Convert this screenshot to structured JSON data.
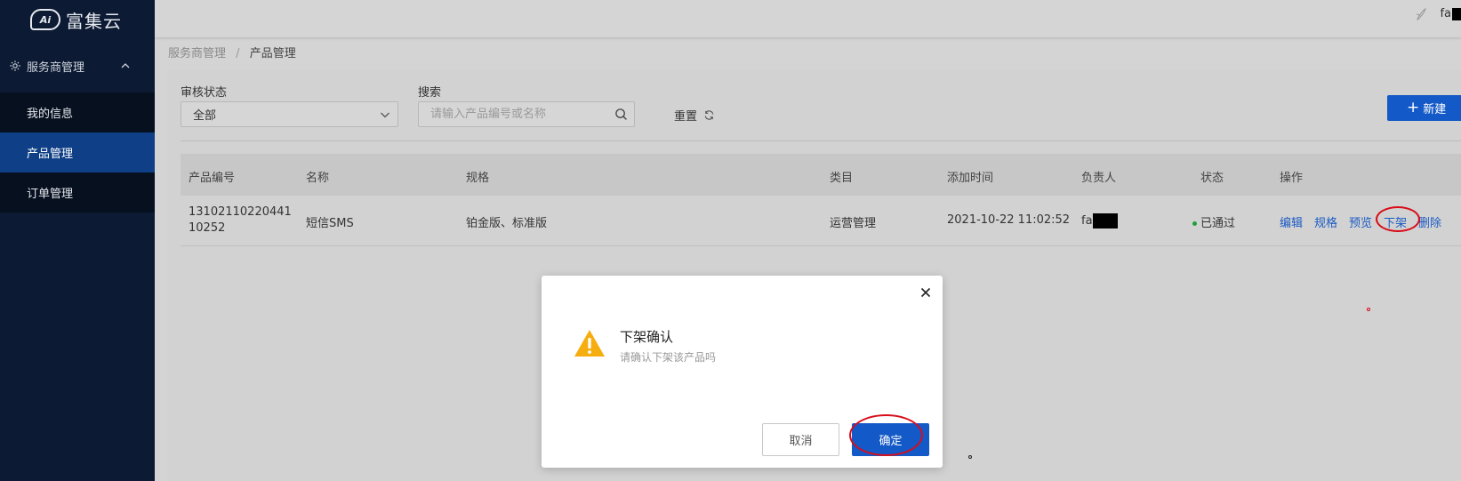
{
  "app": {
    "brand_logo_text": "Ai",
    "brand_name": "富集云"
  },
  "sidebar": {
    "group_label": "服务商管理",
    "items": [
      {
        "label": "我的信息",
        "active": false
      },
      {
        "label": "产品管理",
        "active": true
      },
      {
        "label": "订单管理",
        "active": false
      }
    ]
  },
  "header": {
    "user_name": "fa"
  },
  "breadcrumb": {
    "parent": "服务商管理",
    "separator": "/",
    "current": "产品管理"
  },
  "filters": {
    "status_label": "审核状态",
    "status_value": "全部",
    "search_label": "搜索",
    "search_placeholder": "请输入产品编号或名称",
    "reset_label": "重置",
    "new_label": "新建"
  },
  "table": {
    "columns": [
      "产品编号",
      "名称",
      "规格",
      "类目",
      "添加时间",
      "负责人",
      "状态",
      "操作"
    ],
    "rows": [
      {
        "product_id": "1310211022044110252",
        "name": "短信SMS",
        "spec": "铂金版、标准版",
        "category": "运营管理",
        "added_time": "2021-10-22 11:02:52",
        "owner": "fa",
        "status": "已通过",
        "actions": [
          "编辑",
          "规格",
          "预览",
          "下架",
          "删除"
        ]
      }
    ]
  },
  "modal": {
    "title": "下架确认",
    "message": "请确认下架该产品吗",
    "cancel_label": "取消",
    "confirm_label": "确定"
  },
  "colors": {
    "sidebar_bg": "#0c1a33",
    "active_item": "#0f3f86",
    "primary": "#1359c7",
    "link": "#1b5bc4",
    "status_ok": "#1fa03a",
    "annotation_red": "#d80d1a",
    "warning": "#f6ad0f"
  }
}
